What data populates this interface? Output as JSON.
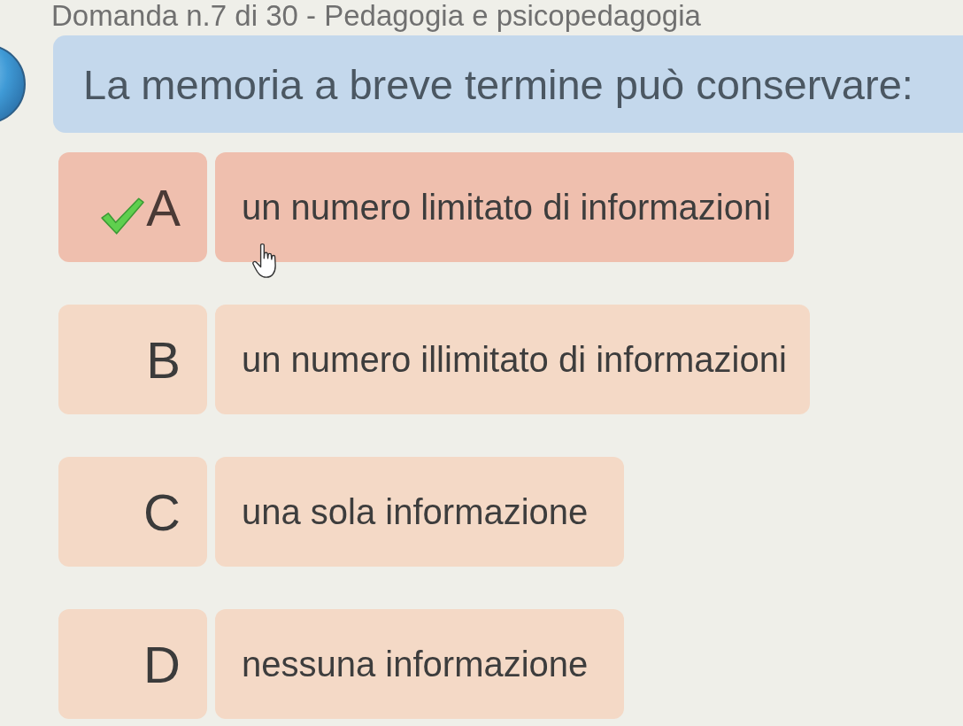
{
  "header": {
    "title": "Domanda n.7 di 30 - Pedagogia e psicopedagogia"
  },
  "question": {
    "text": "La memoria a breve termine può conservare:"
  },
  "options": [
    {
      "letter": "A",
      "text": "un numero limitato di informazioni",
      "selected": true,
      "correct": true
    },
    {
      "letter": "B",
      "text": "un numero illimitato di informazioni",
      "selected": false,
      "correct": false
    },
    {
      "letter": "C",
      "text": "una sola informazione",
      "selected": false,
      "correct": false
    },
    {
      "letter": "D",
      "text": "nessuna informazione",
      "selected": false,
      "correct": false
    }
  ]
}
